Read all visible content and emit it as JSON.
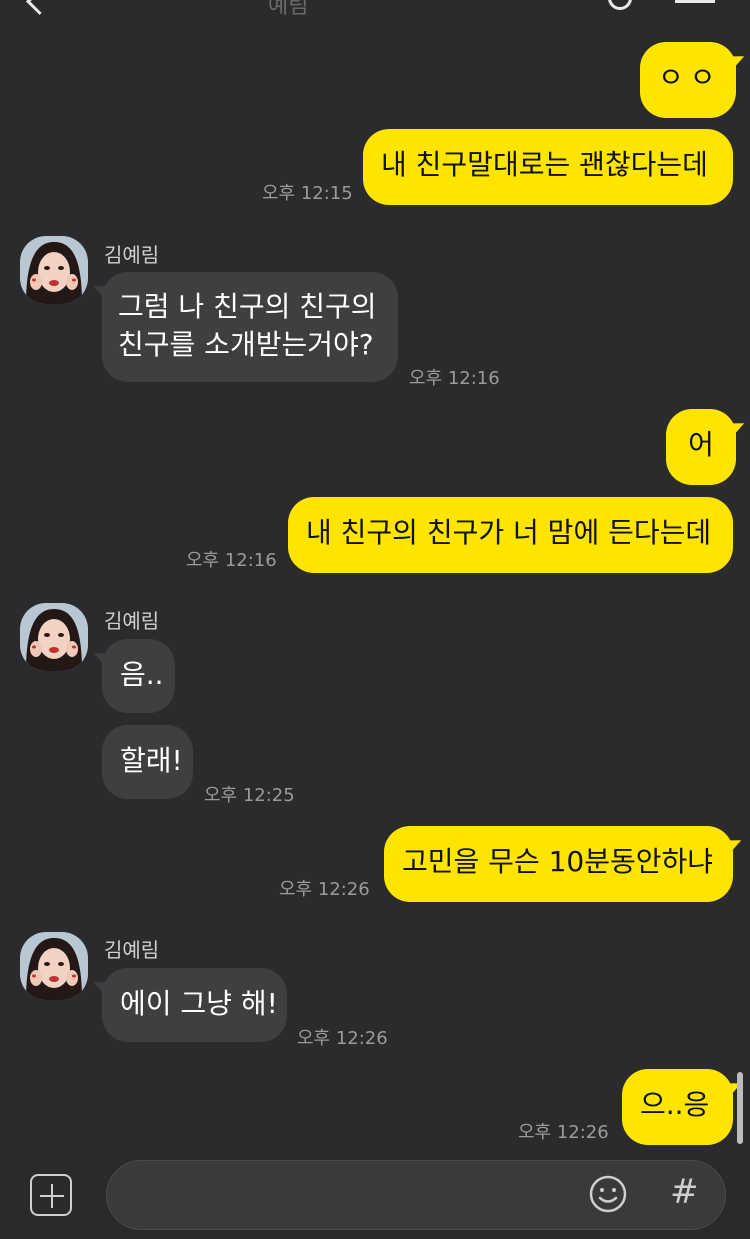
{
  "header": {
    "title": "예림"
  },
  "contact": {
    "name": "김예림"
  },
  "messages": {
    "m1": {
      "text": "ㅇㅇ"
    },
    "m2": {
      "text": "내 친구말대로는 괜찮다는데",
      "time": "오후 12:15"
    },
    "m3": {
      "name": "김예림",
      "line1": "그럼 나 친구의 친구의",
      "line2": "친구를 소개받는거야?",
      "time": "오후 12:16"
    },
    "m4": {
      "text": "어"
    },
    "m5": {
      "text": "내 친구의 친구가 너 맘에 든다는데",
      "time": "오후 12:16"
    },
    "m6": {
      "name": "김예림",
      "text": "음.."
    },
    "m7": {
      "text": "할래!",
      "time": "오후 12:25"
    },
    "m8": {
      "text": "고민을 무슨 10분동안하냐",
      "time": "오후 12:26"
    },
    "m9": {
      "name": "김예림",
      "text": "에이 그냥 해!",
      "time": "오후 12:26"
    },
    "m10": {
      "text": "으..응",
      "time": "오후 12:26"
    }
  },
  "composer": {
    "placeholder": ""
  },
  "icons": {
    "back": "back-chevron-icon",
    "search": "search-icon",
    "menu": "menu-icon",
    "plus": "plus-square-icon",
    "emoji": "smiley-icon",
    "hash": "hash-icon"
  },
  "colors": {
    "background": "#2b2b2d",
    "myBubble": "#fee500",
    "theirBubble": "#3f3f42",
    "timeText": "#9b9b9b"
  }
}
